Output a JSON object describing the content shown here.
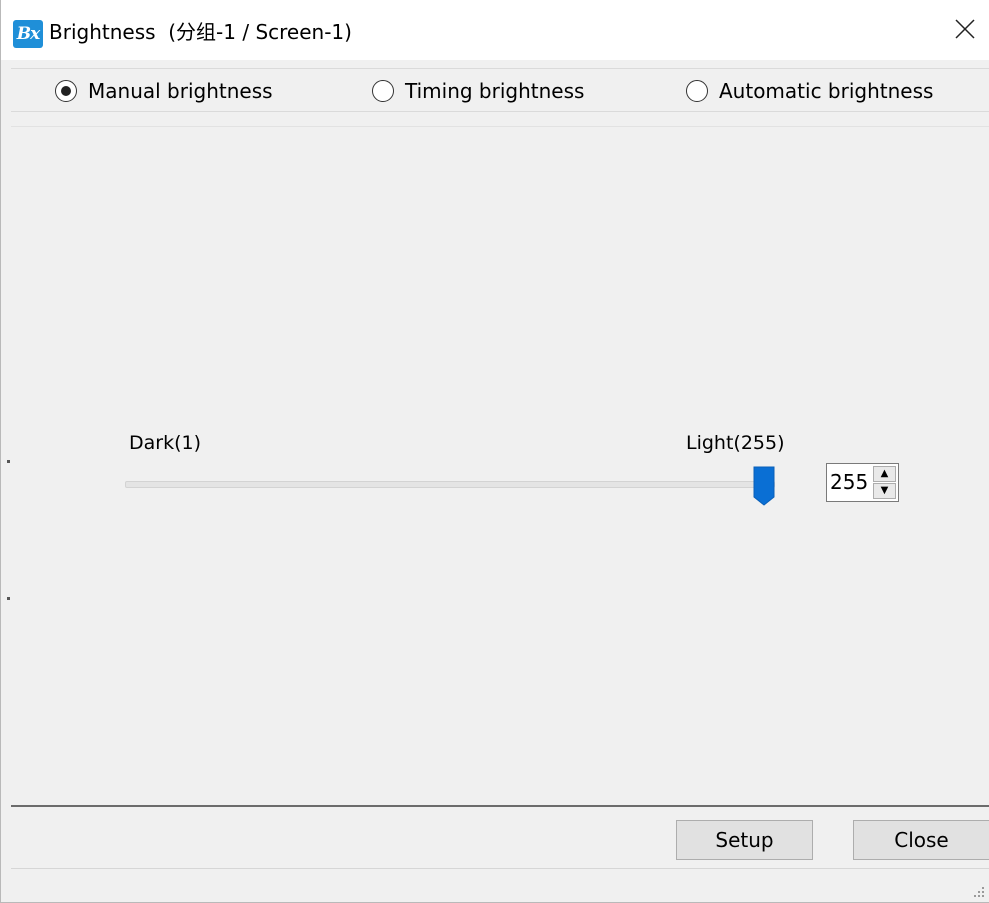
{
  "window": {
    "title": "Brightness  (分组-1 / Screen-1)",
    "app_icon_text": "Bx",
    "icons": {
      "app": "bx-app-icon",
      "close": "close-icon",
      "grip": "resize-grip-icon"
    }
  },
  "modes": [
    {
      "label": "Manual brightness",
      "checked": true
    },
    {
      "label": "Timing brightness",
      "checked": false
    },
    {
      "label": "Automatic brightness",
      "checked": false
    }
  ],
  "slider": {
    "min_label": "Dark(1)",
    "max_label": "Light(255)",
    "min": 1,
    "max": 255,
    "value": 255,
    "accent_color": "#0a6fd4"
  },
  "spinbox": {
    "value": "255",
    "up_glyph": "▲",
    "down_glyph": "▼"
  },
  "buttons": {
    "setup": "Setup",
    "close": "Close"
  }
}
